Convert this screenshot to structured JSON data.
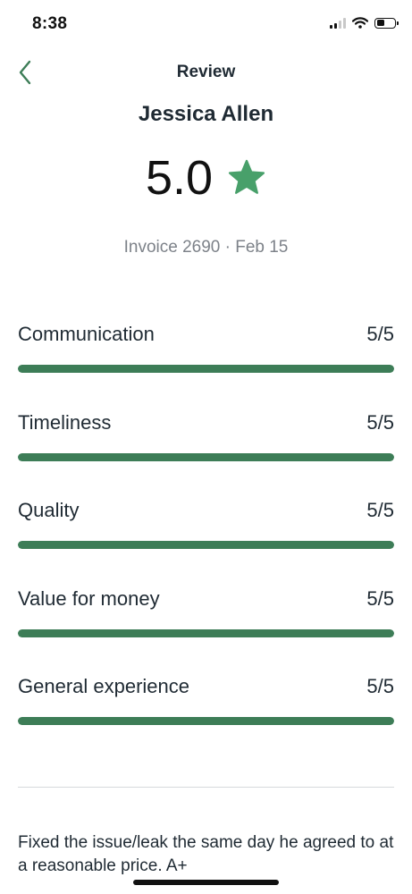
{
  "status_bar": {
    "time": "8:38",
    "icons": [
      "cellular-signal-icon",
      "wifi-icon",
      "battery-icon"
    ]
  },
  "nav": {
    "back_icon": "chevron-left-icon",
    "title": "Review"
  },
  "reviewer": {
    "name": "Jessica Allen"
  },
  "rating": {
    "value": "5.0",
    "icon": "star-icon",
    "star_color": "#48a06a"
  },
  "invoice_line": "Invoice 2690 · Feb 15",
  "categories": [
    {
      "label": "Communication",
      "score": "5/5",
      "fraction": 1.0
    },
    {
      "label": "Timeliness",
      "score": "5/5",
      "fraction": 1.0
    },
    {
      "label": "Quality",
      "score": "5/5",
      "fraction": 1.0
    },
    {
      "label": "Value for money",
      "score": "5/5",
      "fraction": 1.0
    },
    {
      "label": "General experience",
      "score": "5/5",
      "fraction": 1.0
    }
  ],
  "comment": "Fixed the issue/leak the same day he agreed to at a reasonable price. A+",
  "colors": {
    "accent": "#3d7d57",
    "back_chevron": "#3d7d57",
    "muted_text": "#7d8289",
    "text": "#1f2a33"
  }
}
